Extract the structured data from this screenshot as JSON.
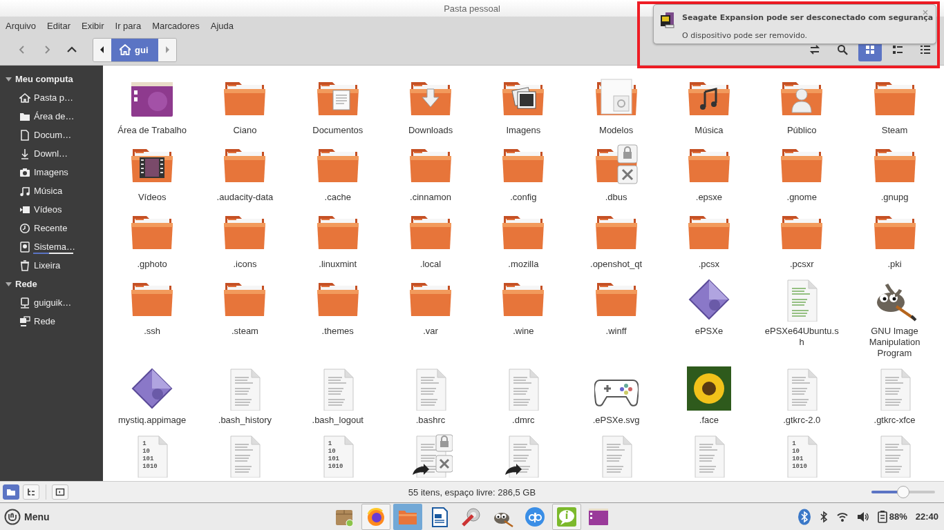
{
  "window": {
    "title": "Pasta pessoal"
  },
  "menu": [
    "Arquivo",
    "Editar",
    "Exibir",
    "Ir para",
    "Marcadores",
    "Ajuda"
  ],
  "breadcrumb": [
    {
      "label": "gui",
      "kind": "home",
      "selected": true
    }
  ],
  "view_buttons": [
    {
      "kind": "icons",
      "selected": true
    },
    {
      "kind": "compact",
      "selected": false
    },
    {
      "kind": "list",
      "selected": false
    }
  ],
  "sidebar": [
    {
      "heading": "Meu computa",
      "expanded": true,
      "items": [
        {
          "label": "Pasta p…",
          "kind": "home"
        },
        {
          "label": "Área de…",
          "kind": "folder"
        },
        {
          "label": "Docum…",
          "kind": "document"
        },
        {
          "label": "Downl…",
          "kind": "download"
        },
        {
          "label": "Imagens",
          "kind": "camera"
        },
        {
          "label": "Música",
          "kind": "music"
        },
        {
          "label": "Vídeos",
          "kind": "video"
        },
        {
          "label": "Recente",
          "kind": "clock"
        },
        {
          "label": "Sistema…",
          "kind": "disk",
          "level": 0.4
        },
        {
          "label": "Lixeira",
          "kind": "trash"
        }
      ]
    },
    {
      "heading": "Rede",
      "expanded": true,
      "items": [
        {
          "label": "guiguik…",
          "kind": "computer"
        },
        {
          "label": "Rede",
          "kind": "network"
        }
      ]
    }
  ],
  "files": [
    {
      "label": "Área de Trabalho",
      "kind": "desktop"
    },
    {
      "label": "Ciano",
      "kind": "folder"
    },
    {
      "label": "Documentos",
      "kind": "folder-documents"
    },
    {
      "label": "Downloads",
      "kind": "folder-downloads"
    },
    {
      "label": "Imagens",
      "kind": "folder-images"
    },
    {
      "label": "Modelos",
      "kind": "folder-templates"
    },
    {
      "label": "Música",
      "kind": "folder-music"
    },
    {
      "label": "Público",
      "kind": "folder-public"
    },
    {
      "label": "Steam",
      "kind": "folder"
    },
    {
      "label": "Vídeos",
      "kind": "folder-videos"
    },
    {
      "label": ".audacity-data",
      "kind": "folder"
    },
    {
      "label": ".cache",
      "kind": "folder"
    },
    {
      "label": ".cinnamon",
      "kind": "folder"
    },
    {
      "label": ".config",
      "kind": "folder"
    },
    {
      "label": ".dbus",
      "kind": "folder-locked"
    },
    {
      "label": ".epsxe",
      "kind": "folder"
    },
    {
      "label": ".gnome",
      "kind": "folder"
    },
    {
      "label": ".gnupg",
      "kind": "folder"
    },
    {
      "label": ".gphoto",
      "kind": "folder"
    },
    {
      "label": ".icons",
      "kind": "folder"
    },
    {
      "label": ".linuxmint",
      "kind": "folder"
    },
    {
      "label": ".local",
      "kind": "folder"
    },
    {
      "label": ".mozilla",
      "kind": "folder"
    },
    {
      "label": ".openshot_qt",
      "kind": "folder"
    },
    {
      "label": ".pcsx",
      "kind": "folder"
    },
    {
      "label": ".pcsxr",
      "kind": "folder"
    },
    {
      "label": ".pki",
      "kind": "folder"
    },
    {
      "label": ".ssh",
      "kind": "folder"
    },
    {
      "label": ".steam",
      "kind": "folder"
    },
    {
      "label": ".themes",
      "kind": "folder"
    },
    {
      "label": ".var",
      "kind": "folder"
    },
    {
      "label": ".wine",
      "kind": "folder"
    },
    {
      "label": ".winff",
      "kind": "folder"
    },
    {
      "label": "ePSXe",
      "kind": "diamond-app"
    },
    {
      "label": "ePSXe64Ubuntu.sh",
      "kind": "script"
    },
    {
      "label": "GNU Image Manipulation Program",
      "kind": "gimp"
    },
    {
      "label": "mystiq.appimage",
      "kind": "diamond-app"
    },
    {
      "label": ".bash_history",
      "kind": "text"
    },
    {
      "label": ".bash_logout",
      "kind": "text"
    },
    {
      "label": ".bashrc",
      "kind": "text"
    },
    {
      "label": ".dmrc",
      "kind": "text"
    },
    {
      "label": ".ePSXe.svg",
      "kind": "gamepad"
    },
    {
      "label": ".face",
      "kind": "photo"
    },
    {
      "label": ".gtkrc-2.0",
      "kind": "text"
    },
    {
      "label": ".gtkrc-xfce",
      "kind": "text"
    },
    {
      "kind": "binary",
      "icon_lines": [
        "1",
        "10",
        "101",
        "1010"
      ]
    },
    {
      "kind": "text"
    },
    {
      "kind": "binary",
      "icon_lines": [
        "1",
        "10",
        "101",
        "1010"
      ]
    },
    {
      "kind": "text-locked-link"
    },
    {
      "kind": "text-link"
    },
    {
      "kind": "text"
    },
    {
      "kind": "text"
    },
    {
      "kind": "binary",
      "icon_lines": [
        "1",
        "10",
        "101",
        "1010"
      ]
    },
    {
      "kind": "text"
    }
  ],
  "status_bar": {
    "pane_buttons": [
      {
        "kind": "places",
        "selected": true
      },
      {
        "kind": "tree",
        "selected": false
      }
    ],
    "text": "55 itens, espaço livre: 286,5 GB",
    "zoom": {
      "level": 0.5
    }
  },
  "taskbar": {
    "menu_label": "Menu",
    "launchers": [
      {
        "kind": "package",
        "active": false,
        "open": false
      },
      {
        "kind": "firefox",
        "active": false,
        "open": true
      },
      {
        "kind": "files",
        "active": true,
        "open": false
      },
      {
        "kind": "writer",
        "active": false,
        "open": false
      },
      {
        "kind": "settings",
        "active": false,
        "open": false
      },
      {
        "kind": "gimp",
        "active": false,
        "open": false
      },
      {
        "kind": "qbittorrent",
        "active": false,
        "open": false
      },
      {
        "kind": "info",
        "active": false,
        "open": true
      },
      {
        "kind": "desktop",
        "active": false,
        "open": false
      }
    ],
    "battery": "88%",
    "clock": "22:40"
  },
  "notification": {
    "title": "Seagate Expansion pode ser desconectado com segurança",
    "body": "O dispositivo pode ser removido.",
    "highlighted": true
  }
}
